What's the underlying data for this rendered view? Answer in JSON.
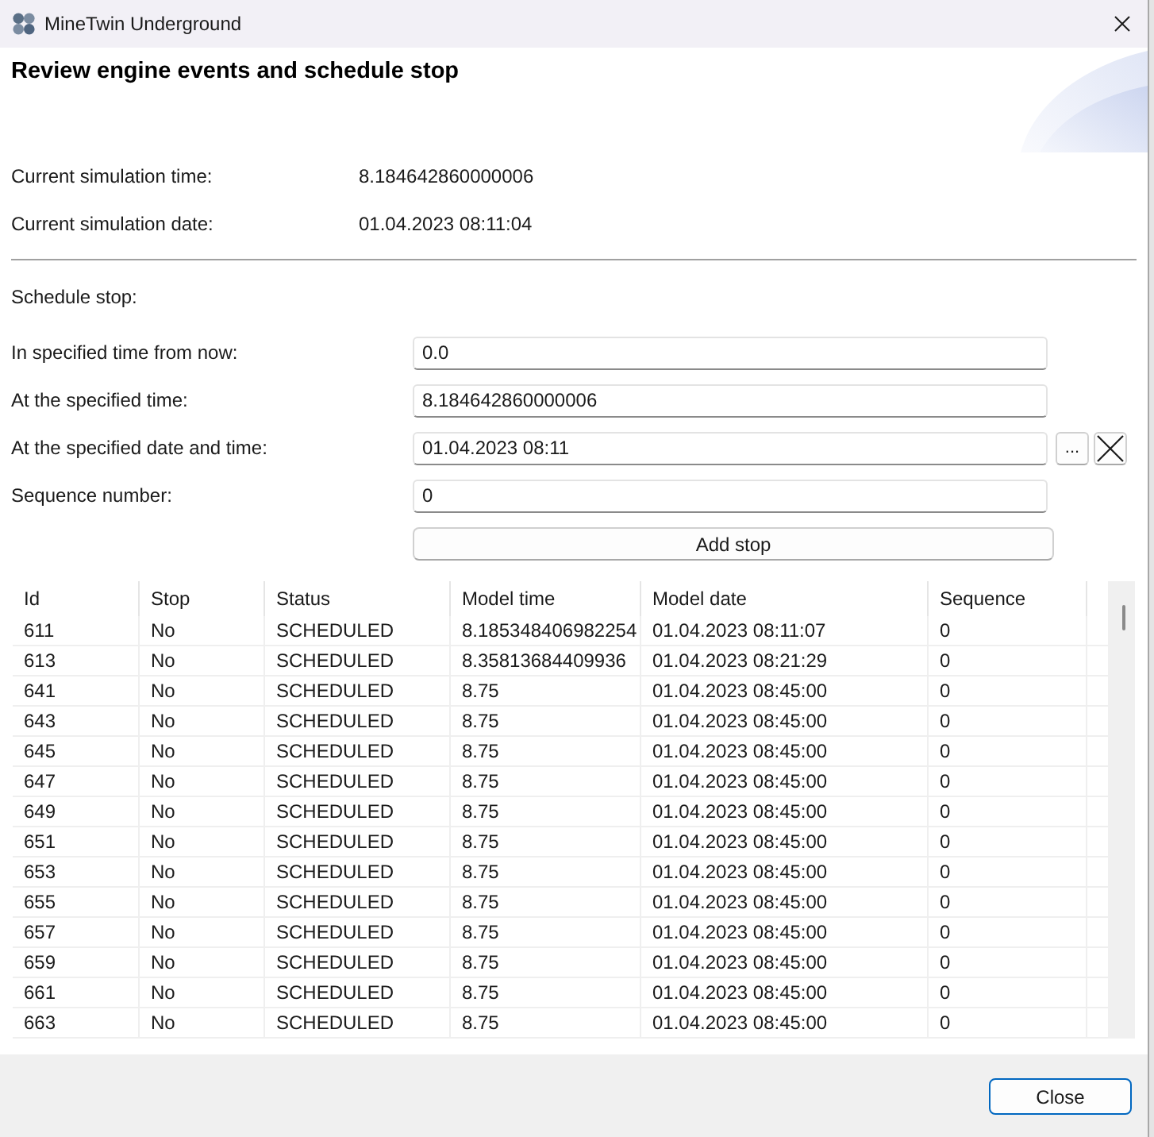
{
  "window": {
    "title": "MineTwin Underground"
  },
  "header": {
    "title": "Review engine events and schedule stop"
  },
  "status": [
    {
      "label": "Current simulation time:",
      "value": "8.184642860000006"
    },
    {
      "label": "Current simulation date:",
      "value": "01.04.2023 08:11:04"
    }
  ],
  "schedule": {
    "heading": "Schedule stop:",
    "fields": [
      {
        "kind": "text",
        "label": "In specified time from now:",
        "value": "0.0"
      },
      {
        "kind": "text",
        "label": "At the specified time:",
        "value": "8.184642860000006"
      },
      {
        "kind": "datetime",
        "label": "At the specified date and time:",
        "value": "01.04.2023 08:11",
        "picker_button": "..."
      },
      {
        "kind": "text",
        "label": "Sequence number:",
        "value": "0"
      }
    ],
    "add_button": "Add stop"
  },
  "table": {
    "columns": [
      "Id",
      "Stop",
      "Status",
      "Model time",
      "Model date",
      "Sequence"
    ],
    "rows": [
      [
        "611",
        "No",
        "SCHEDULED",
        "8.185348406982254",
        "01.04.2023 08:11:07",
        "0"
      ],
      [
        "613",
        "No",
        "SCHEDULED",
        "8.35813684409936",
        "01.04.2023 08:21:29",
        "0"
      ],
      [
        "641",
        "No",
        "SCHEDULED",
        "8.75",
        "01.04.2023 08:45:00",
        "0"
      ],
      [
        "643",
        "No",
        "SCHEDULED",
        "8.75",
        "01.04.2023 08:45:00",
        "0"
      ],
      [
        "645",
        "No",
        "SCHEDULED",
        "8.75",
        "01.04.2023 08:45:00",
        "0"
      ],
      [
        "647",
        "No",
        "SCHEDULED",
        "8.75",
        "01.04.2023 08:45:00",
        "0"
      ],
      [
        "649",
        "No",
        "SCHEDULED",
        "8.75",
        "01.04.2023 08:45:00",
        "0"
      ],
      [
        "651",
        "No",
        "SCHEDULED",
        "8.75",
        "01.04.2023 08:45:00",
        "0"
      ],
      [
        "653",
        "No",
        "SCHEDULED",
        "8.75",
        "01.04.2023 08:45:00",
        "0"
      ],
      [
        "655",
        "No",
        "SCHEDULED",
        "8.75",
        "01.04.2023 08:45:00",
        "0"
      ],
      [
        "657",
        "No",
        "SCHEDULED",
        "8.75",
        "01.04.2023 08:45:00",
        "0"
      ],
      [
        "659",
        "No",
        "SCHEDULED",
        "8.75",
        "01.04.2023 08:45:00",
        "0"
      ],
      [
        "661",
        "No",
        "SCHEDULED",
        "8.75",
        "01.04.2023 08:45:00",
        "0"
      ],
      [
        "663",
        "No",
        "SCHEDULED",
        "8.75",
        "01.04.2023 08:45:00",
        "0"
      ]
    ]
  },
  "footer": {
    "close_button": "Close"
  }
}
